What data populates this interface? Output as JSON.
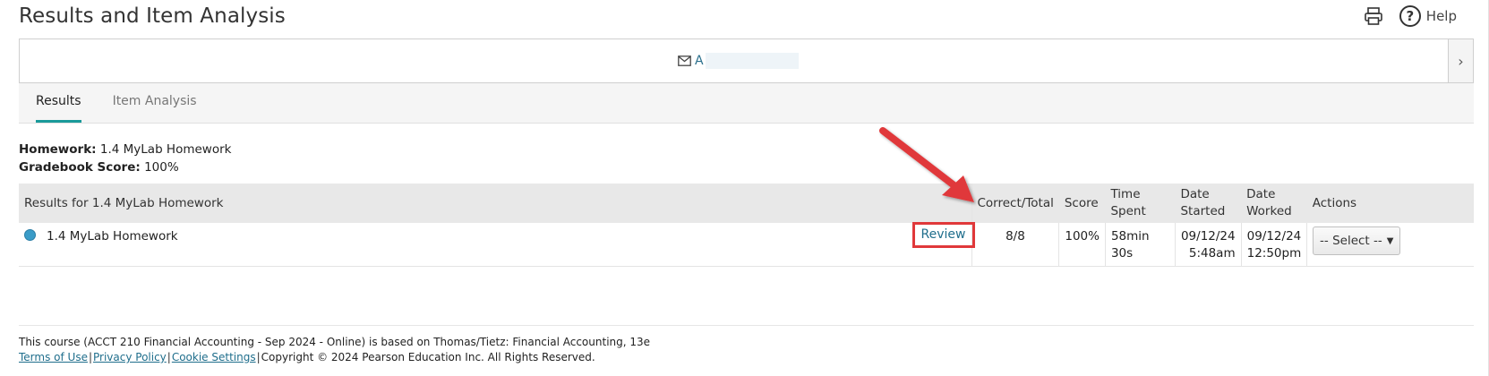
{
  "header": {
    "title": "Results and Item Analysis",
    "print_icon": "printer-icon",
    "help_label": "Help"
  },
  "student": {
    "email_prefix": "A"
  },
  "tabs": [
    {
      "label": "Results",
      "active": true
    },
    {
      "label": "Item Analysis",
      "active": false
    }
  ],
  "summary": {
    "homework_label": "Homework:",
    "homework_value": "1.4 MyLab Homework",
    "score_label": "Gradebook Score:",
    "score_value": "100%"
  },
  "table": {
    "headers": {
      "results": "Results for 1.4 MyLab Homework",
      "correct_total": "Correct/Total",
      "score": "Score",
      "time_spent_1": "Time",
      "time_spent_2": "Spent",
      "date_started_1": "Date",
      "date_started_2": "Started",
      "date_worked_1": "Date",
      "date_worked_2": "Worked",
      "actions": "Actions"
    },
    "row": {
      "name": "1.4 MyLab Homework",
      "review": "Review",
      "correct_total": "8/8",
      "score": "100%",
      "time_spent": "58min 30s",
      "date_started_1": "09/12/24",
      "date_started_2": "5:48am",
      "date_worked_1": "09/12/24",
      "date_worked_2": "12:50pm",
      "action_select": "-- Select --"
    }
  },
  "footer": {
    "course_text": "This course (ACCT 210 Financial Accounting - Sep 2024 - Online) is based on Thomas/Tietz: Financial Accounting, 13e",
    "terms": "Terms of Use",
    "privacy": "Privacy Policy",
    "cookies": "Cookie Settings",
    "copyright": "Copyright © 2024 Pearson Education Inc. All Rights Reserved."
  },
  "colors": {
    "accent_teal": "#1a9a9a",
    "link_blue": "#1f6e8c",
    "annotation_red": "#e0383a",
    "status_dot": "#3a9cc8"
  }
}
